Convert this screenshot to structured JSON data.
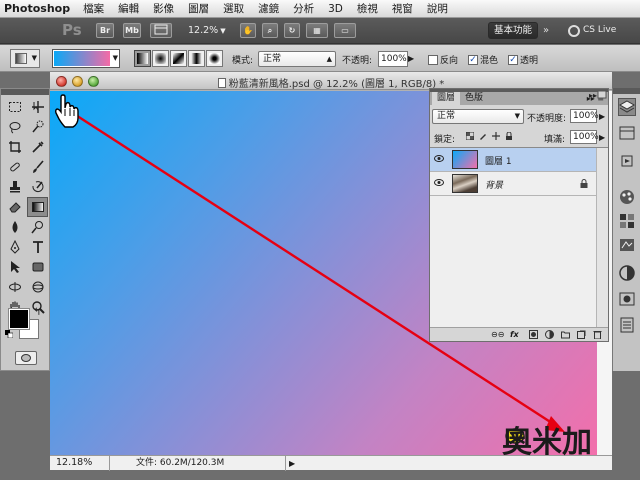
{
  "menubar": {
    "app_name": "Photoshop",
    "items": [
      "檔案",
      "編輯",
      "影像",
      "圖層",
      "選取",
      "濾鏡",
      "分析",
      "3D",
      "檢視",
      "視窗",
      "說明"
    ]
  },
  "appbar": {
    "logo": "Ps",
    "bridge_icon": "Br",
    "minibridge_icon": "Mb",
    "zoom_level": "12.2%",
    "workspace": "基本功能",
    "cslive": "CS Live"
  },
  "options": {
    "mode_label": "模式:",
    "mode_value": "正常",
    "opacity_label": "不透明:",
    "opacity_value": "100%",
    "reverse_label": "反向",
    "dither_label": "混色",
    "transparency_label": "透明",
    "reverse_checked": false,
    "dither_checked": true,
    "transparency_checked": true
  },
  "document": {
    "title": "粉藍清新風格.psd @ 12.2% (圖層 1, RGB/8) *",
    "status_zoom": "12.18%",
    "status_info": "文件: 60.2M/120.3M",
    "gradient_start_color": "#0aa9f8",
    "gradient_end_color": "#f26fab",
    "drag_line_color": "#e60012"
  },
  "layers": {
    "tab_layers": "圖層",
    "tab_channels": "色版",
    "blend_mode": "正常",
    "opacity_label": "不透明度:",
    "opacity_value": "100%",
    "lock_label": "鎖定:",
    "fill_label": "填滿:",
    "fill_value": "100%",
    "items": [
      {
        "name": "圖層 1",
        "selected": true
      },
      {
        "name": "背景",
        "selected": false,
        "locked": true
      }
    ]
  },
  "watermark": {
    "text": "奧米加"
  }
}
